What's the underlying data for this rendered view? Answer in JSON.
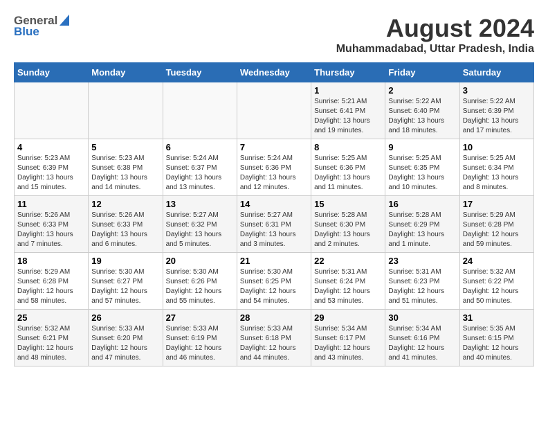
{
  "header": {
    "logo_general": "General",
    "logo_blue": "Blue",
    "title": "August 2024",
    "subtitle": "Muhammadabad, Uttar Pradesh, India"
  },
  "weekdays": [
    "Sunday",
    "Monday",
    "Tuesday",
    "Wednesday",
    "Thursday",
    "Friday",
    "Saturday"
  ],
  "weeks": [
    [
      {
        "day": "",
        "info": ""
      },
      {
        "day": "",
        "info": ""
      },
      {
        "day": "",
        "info": ""
      },
      {
        "day": "",
        "info": ""
      },
      {
        "day": "1",
        "info": "Sunrise: 5:21 AM\nSunset: 6:41 PM\nDaylight: 13 hours\nand 19 minutes."
      },
      {
        "day": "2",
        "info": "Sunrise: 5:22 AM\nSunset: 6:40 PM\nDaylight: 13 hours\nand 18 minutes."
      },
      {
        "day": "3",
        "info": "Sunrise: 5:22 AM\nSunset: 6:39 PM\nDaylight: 13 hours\nand 17 minutes."
      }
    ],
    [
      {
        "day": "4",
        "info": "Sunrise: 5:23 AM\nSunset: 6:39 PM\nDaylight: 13 hours\nand 15 minutes."
      },
      {
        "day": "5",
        "info": "Sunrise: 5:23 AM\nSunset: 6:38 PM\nDaylight: 13 hours\nand 14 minutes."
      },
      {
        "day": "6",
        "info": "Sunrise: 5:24 AM\nSunset: 6:37 PM\nDaylight: 13 hours\nand 13 minutes."
      },
      {
        "day": "7",
        "info": "Sunrise: 5:24 AM\nSunset: 6:36 PM\nDaylight: 13 hours\nand 12 minutes."
      },
      {
        "day": "8",
        "info": "Sunrise: 5:25 AM\nSunset: 6:36 PM\nDaylight: 13 hours\nand 11 minutes."
      },
      {
        "day": "9",
        "info": "Sunrise: 5:25 AM\nSunset: 6:35 PM\nDaylight: 13 hours\nand 10 minutes."
      },
      {
        "day": "10",
        "info": "Sunrise: 5:25 AM\nSunset: 6:34 PM\nDaylight: 13 hours\nand 8 minutes."
      }
    ],
    [
      {
        "day": "11",
        "info": "Sunrise: 5:26 AM\nSunset: 6:33 PM\nDaylight: 13 hours\nand 7 minutes."
      },
      {
        "day": "12",
        "info": "Sunrise: 5:26 AM\nSunset: 6:33 PM\nDaylight: 13 hours\nand 6 minutes."
      },
      {
        "day": "13",
        "info": "Sunrise: 5:27 AM\nSunset: 6:32 PM\nDaylight: 13 hours\nand 5 minutes."
      },
      {
        "day": "14",
        "info": "Sunrise: 5:27 AM\nSunset: 6:31 PM\nDaylight: 13 hours\nand 3 minutes."
      },
      {
        "day": "15",
        "info": "Sunrise: 5:28 AM\nSunset: 6:30 PM\nDaylight: 13 hours\nand 2 minutes."
      },
      {
        "day": "16",
        "info": "Sunrise: 5:28 AM\nSunset: 6:29 PM\nDaylight: 13 hours\nand 1 minute."
      },
      {
        "day": "17",
        "info": "Sunrise: 5:29 AM\nSunset: 6:28 PM\nDaylight: 12 hours\nand 59 minutes."
      }
    ],
    [
      {
        "day": "18",
        "info": "Sunrise: 5:29 AM\nSunset: 6:28 PM\nDaylight: 12 hours\nand 58 minutes."
      },
      {
        "day": "19",
        "info": "Sunrise: 5:30 AM\nSunset: 6:27 PM\nDaylight: 12 hours\nand 57 minutes."
      },
      {
        "day": "20",
        "info": "Sunrise: 5:30 AM\nSunset: 6:26 PM\nDaylight: 12 hours\nand 55 minutes."
      },
      {
        "day": "21",
        "info": "Sunrise: 5:30 AM\nSunset: 6:25 PM\nDaylight: 12 hours\nand 54 minutes."
      },
      {
        "day": "22",
        "info": "Sunrise: 5:31 AM\nSunset: 6:24 PM\nDaylight: 12 hours\nand 53 minutes."
      },
      {
        "day": "23",
        "info": "Sunrise: 5:31 AM\nSunset: 6:23 PM\nDaylight: 12 hours\nand 51 minutes."
      },
      {
        "day": "24",
        "info": "Sunrise: 5:32 AM\nSunset: 6:22 PM\nDaylight: 12 hours\nand 50 minutes."
      }
    ],
    [
      {
        "day": "25",
        "info": "Sunrise: 5:32 AM\nSunset: 6:21 PM\nDaylight: 12 hours\nand 48 minutes."
      },
      {
        "day": "26",
        "info": "Sunrise: 5:33 AM\nSunset: 6:20 PM\nDaylight: 12 hours\nand 47 minutes."
      },
      {
        "day": "27",
        "info": "Sunrise: 5:33 AM\nSunset: 6:19 PM\nDaylight: 12 hours\nand 46 minutes."
      },
      {
        "day": "28",
        "info": "Sunrise: 5:33 AM\nSunset: 6:18 PM\nDaylight: 12 hours\nand 44 minutes."
      },
      {
        "day": "29",
        "info": "Sunrise: 5:34 AM\nSunset: 6:17 PM\nDaylight: 12 hours\nand 43 minutes."
      },
      {
        "day": "30",
        "info": "Sunrise: 5:34 AM\nSunset: 6:16 PM\nDaylight: 12 hours\nand 41 minutes."
      },
      {
        "day": "31",
        "info": "Sunrise: 5:35 AM\nSunset: 6:15 PM\nDaylight: 12 hours\nand 40 minutes."
      }
    ]
  ]
}
